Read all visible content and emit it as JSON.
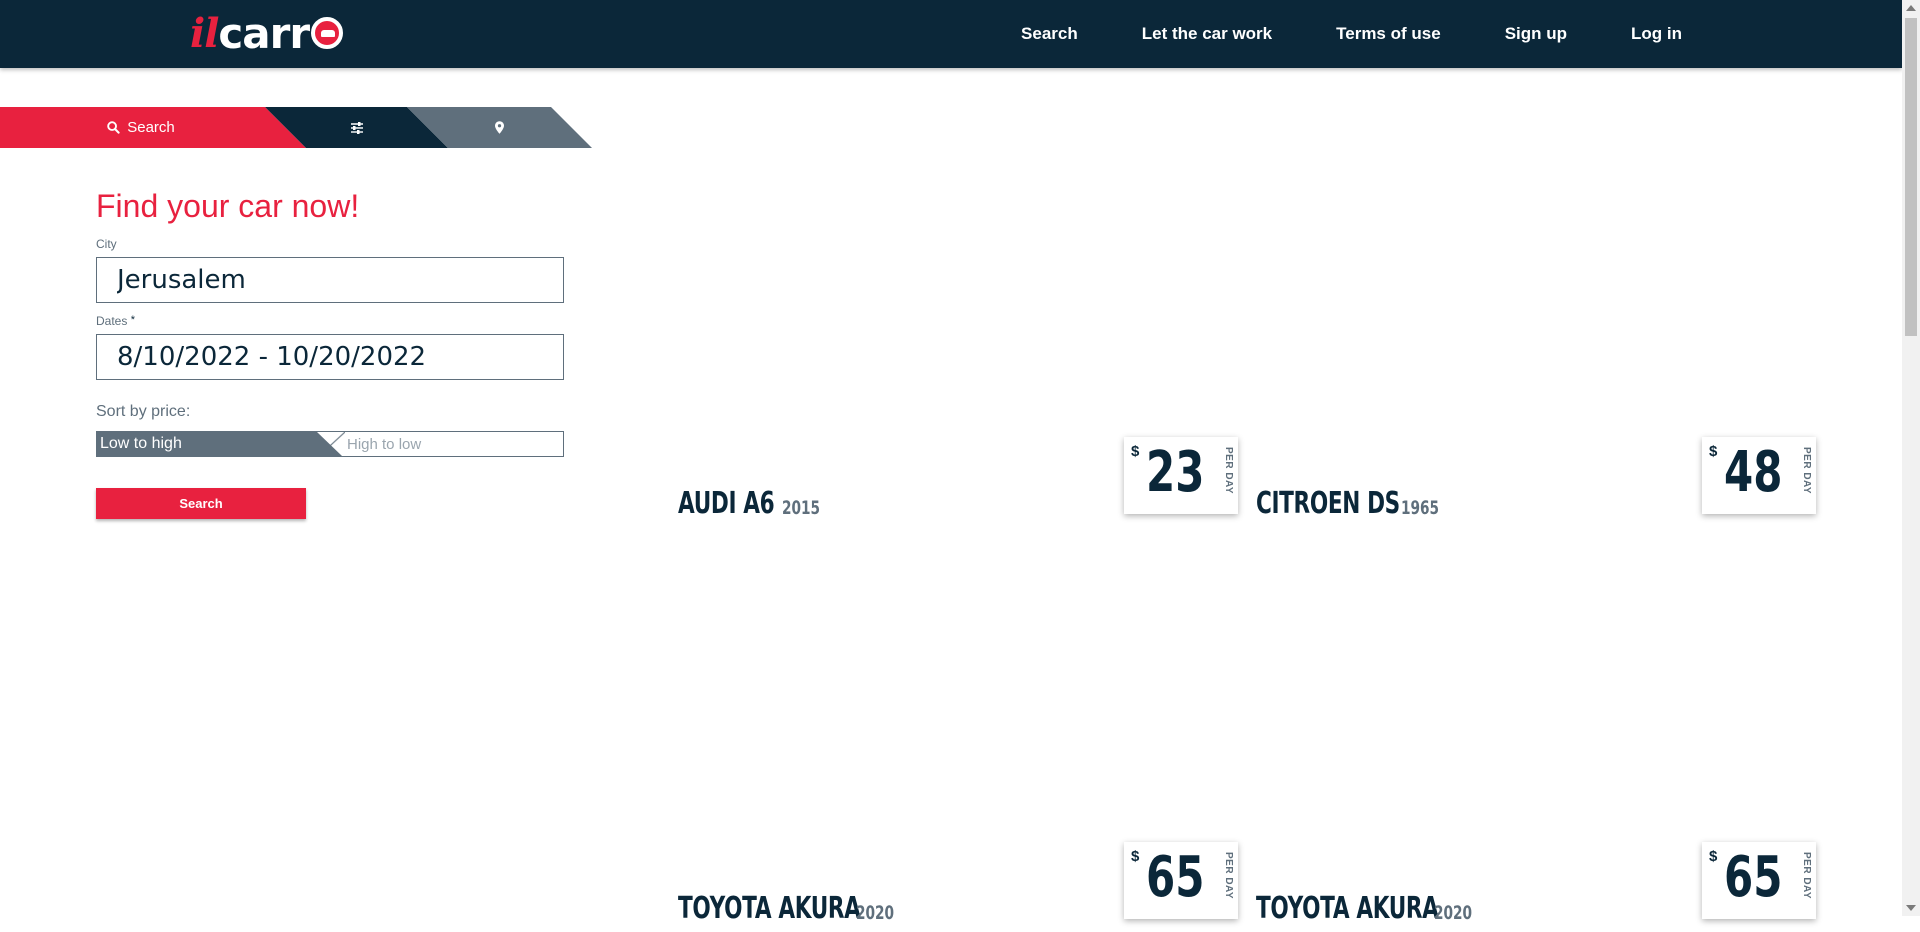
{
  "header": {
    "logo_prefix": "il",
    "logo_main": "carr",
    "nav": [
      "Search",
      "Let the car work",
      "Terms of use",
      "Sign up",
      "Log in"
    ]
  },
  "tabs": {
    "search_label": "Search",
    "search_icon": "search-icon",
    "filter_icon": "sliders-icon",
    "map_icon": "map-pin-icon"
  },
  "form": {
    "title": "Find your car now!",
    "city_label": "City",
    "city_value": "Jerusalem",
    "dates_label": "Dates",
    "dates_required": "*",
    "dates_value": "8/10/2022 - 10/20/2022",
    "sort_label": "Sort by price:",
    "sort_low": "Low to high",
    "sort_high": "High to low",
    "search_button": "Search"
  },
  "cars": [
    {
      "name": "AUDI A6",
      "year": "2015",
      "currency": "$",
      "price": "23",
      "per": "PER DAY"
    },
    {
      "name": "CITROEN DS",
      "year": "1965",
      "currency": "$",
      "price": "48",
      "per": "PER DAY"
    },
    {
      "name": "TOYOTA AKURA",
      "year": "2020",
      "currency": "$",
      "price": "65",
      "per": "PER DAY"
    },
    {
      "name": "TOYOTA AKURA",
      "year": "2020",
      "currency": "$",
      "price": "65",
      "per": "PER DAY"
    }
  ],
  "colors": {
    "brand_red": "#e8213f",
    "navy": "#0b2739",
    "slate": "#5f6f7c"
  }
}
